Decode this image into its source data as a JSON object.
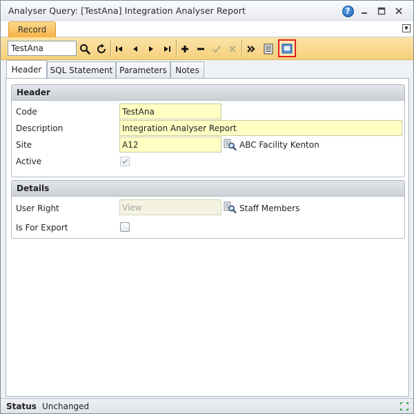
{
  "window": {
    "title": "Analyser Query: [TestAna] Integration Analyser Report"
  },
  "ribbon": {
    "tab_label": "Record"
  },
  "toolbar": {
    "search_value": "TestAna",
    "buttons": [
      "search-icon",
      "refresh-icon",
      "first-record-icon",
      "previous-record-icon",
      "next-record-icon",
      "last-record-icon",
      "add-icon",
      "remove-icon",
      "confirm-icon",
      "cancel-icon",
      "more-icon",
      "list-view-icon",
      "form-view-icon"
    ]
  },
  "tabs": [
    {
      "label": "Header"
    },
    {
      "label": "SQL Statement"
    },
    {
      "label": "Parameters"
    },
    {
      "label": "Notes"
    }
  ],
  "header_group": {
    "title": "Header",
    "code": {
      "label": "Code",
      "value": "TestAna"
    },
    "description": {
      "label": "Description",
      "value": "Integration Analyser Report"
    },
    "site": {
      "label": "Site",
      "value": "A12",
      "lookup_text": "ABC Facility Kenton"
    },
    "active": {
      "label": "Active",
      "checked": true
    }
  },
  "details_group": {
    "title": "Details",
    "user_right": {
      "label": "User Right",
      "placeholder": "View",
      "lookup_text": "Staff Members"
    },
    "is_for_export": {
      "label": "Is For Export",
      "checked": false
    }
  },
  "status": {
    "label": "Status",
    "value": "Unchanged"
  },
  "colors": {
    "accent": "#f6d07c",
    "highlight": "#e01d1d",
    "field_bg": "#ffffc4"
  }
}
